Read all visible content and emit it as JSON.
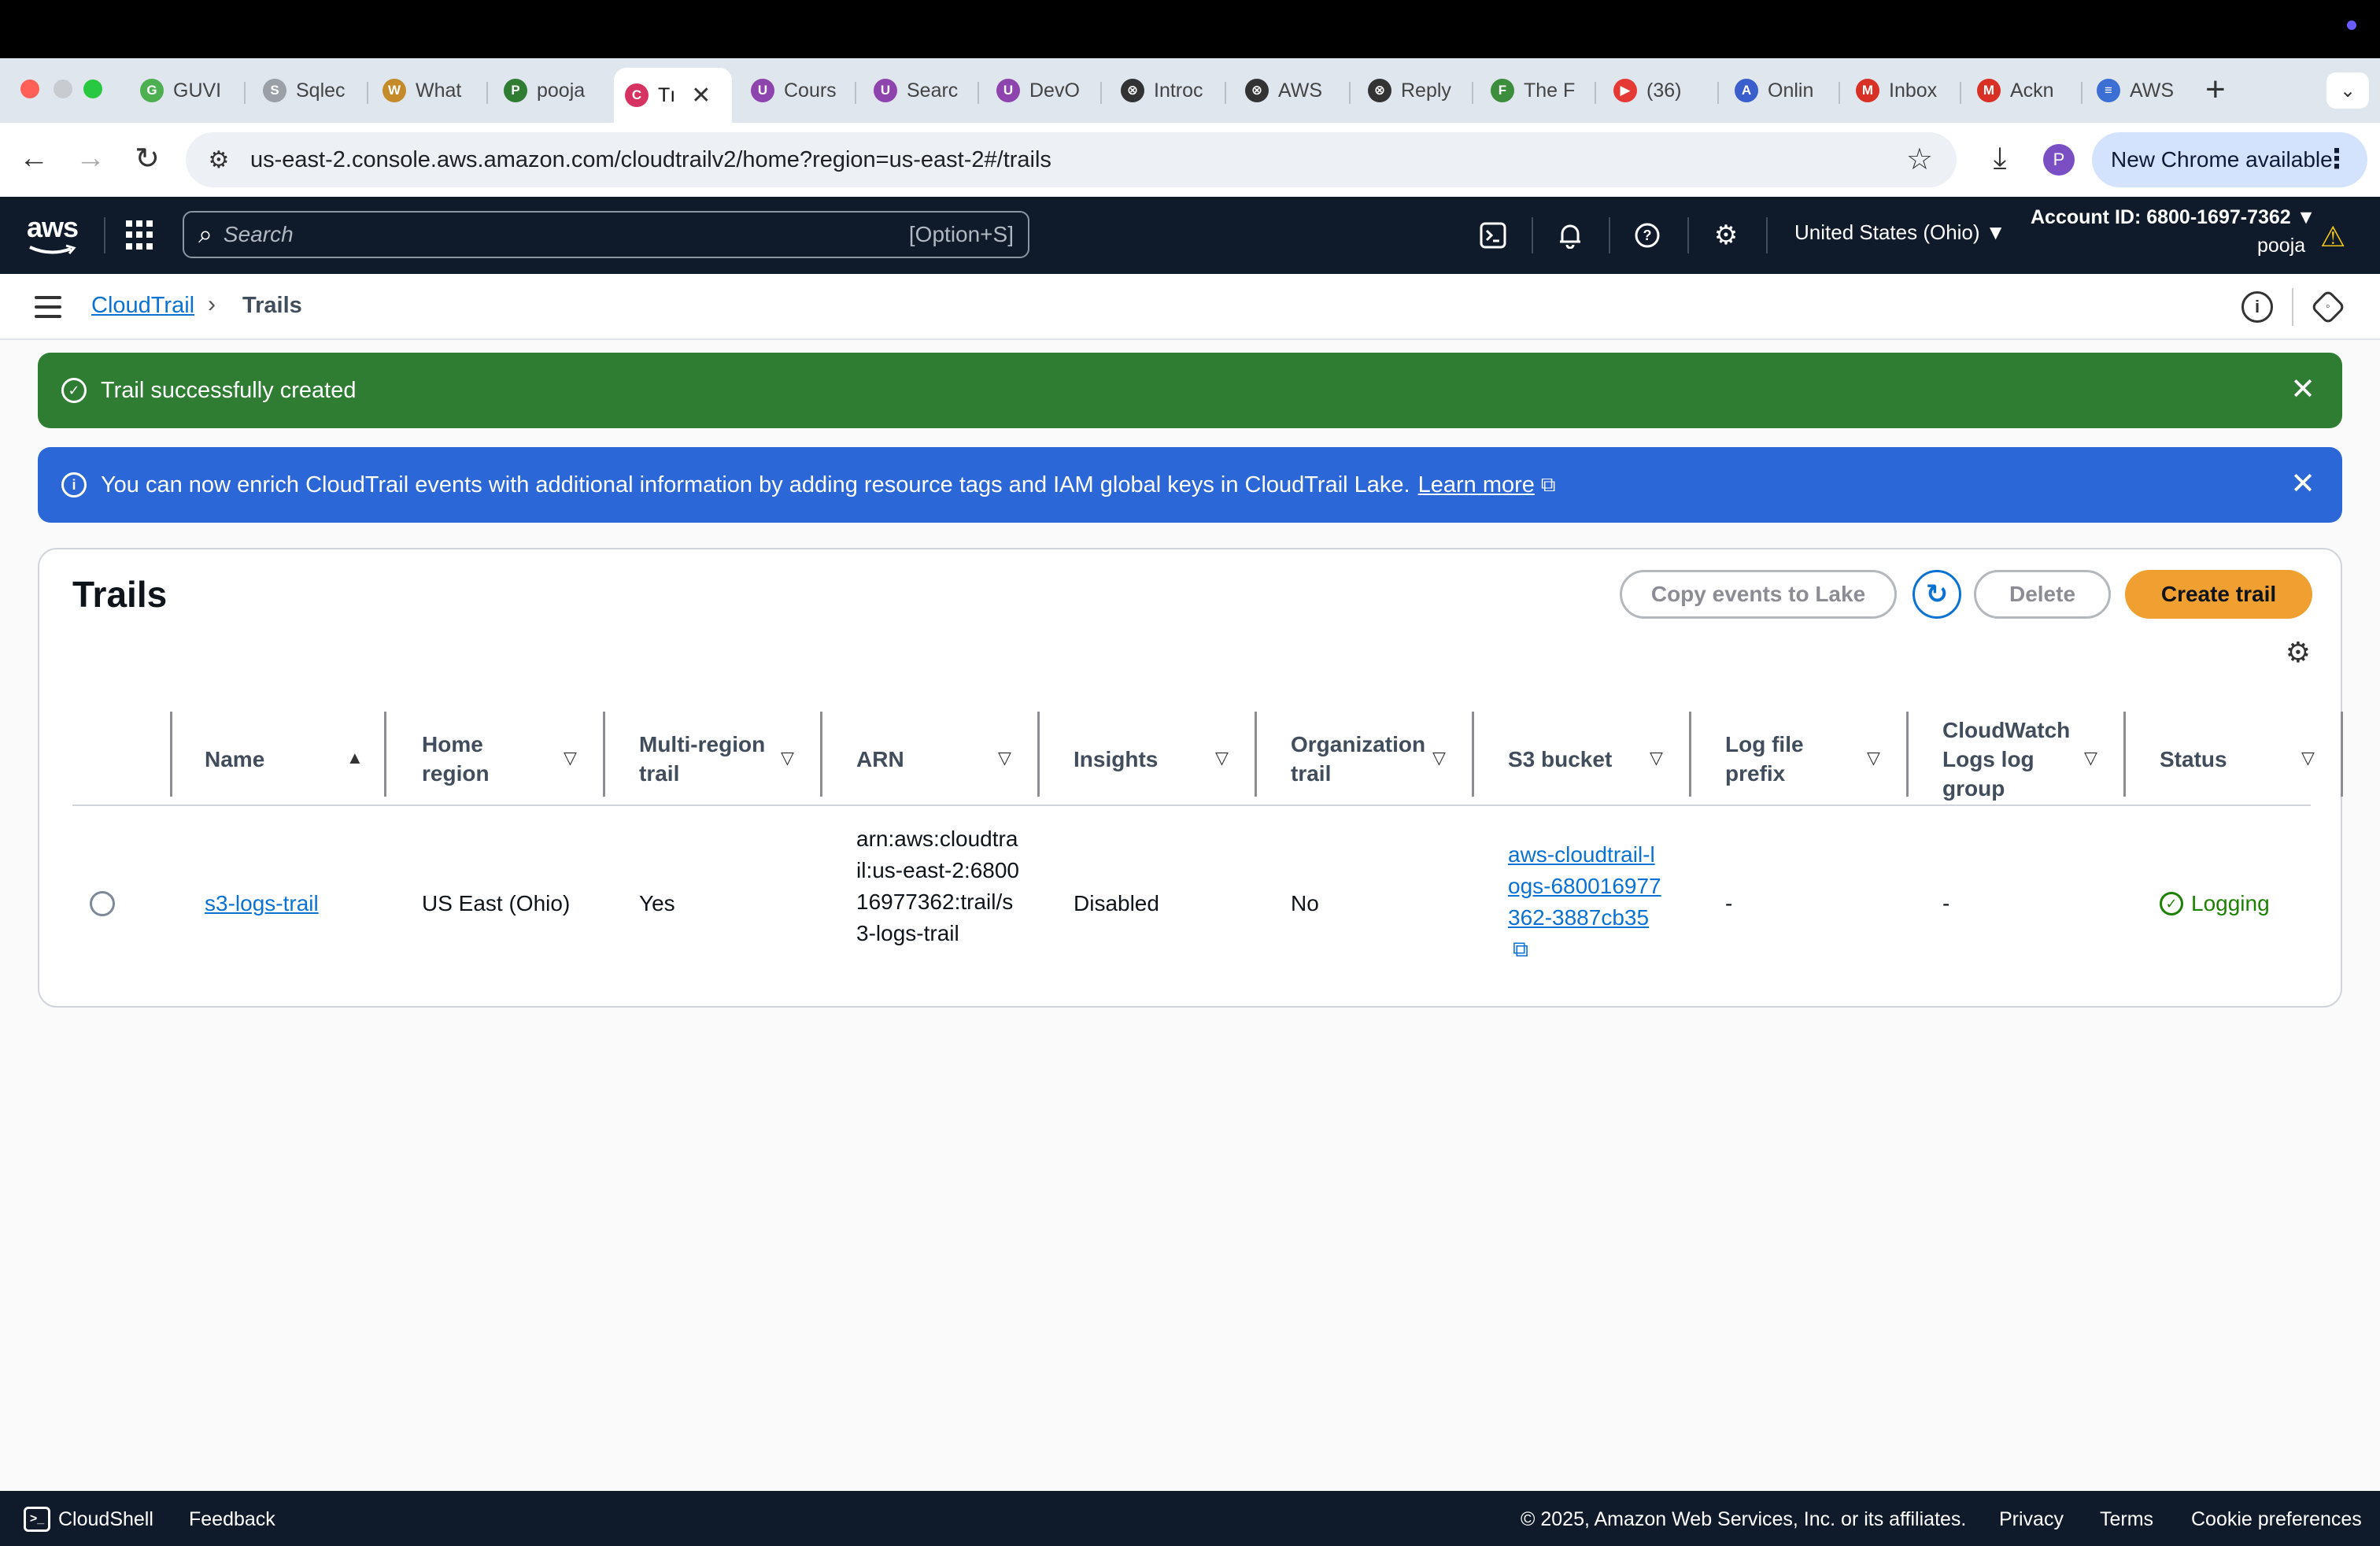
{
  "browser": {
    "tabs": [
      {
        "label": "GUVI",
        "fav_color": "#4caf50",
        "fav": "G"
      },
      {
        "label": "Sqlec",
        "fav_color": "#9aa0a6",
        "fav": "S"
      },
      {
        "label": "What",
        "fav_color": "#c58b2a",
        "fav": "W"
      },
      {
        "label": "pooja",
        "fav_color": "#2e7d32",
        "fav": "P"
      },
      {
        "label": "Tı",
        "fav_color": "#d63262",
        "fav": "C"
      },
      {
        "label": "Cours",
        "fav_color": "#8e44ad",
        "fav": "U"
      },
      {
        "label": "Searc",
        "fav_color": "#8e44ad",
        "fav": "U"
      },
      {
        "label": "DevO",
        "fav_color": "#8e44ad",
        "fav": "U"
      },
      {
        "label": "Introc",
        "fav_color": "#333333",
        "fav": "⊗"
      },
      {
        "label": "AWS",
        "fav_color": "#333333",
        "fav": "⊗"
      },
      {
        "label": "Reply",
        "fav_color": "#333333",
        "fav": "⊗"
      },
      {
        "label": "The F",
        "fav_color": "#3c8d3c",
        "fav": "F"
      },
      {
        "label": "(36) ",
        "fav_color": "#e53935",
        "fav": "▶"
      },
      {
        "label": "Onlin",
        "fav_color": "#3a5fcd",
        "fav": "A"
      },
      {
        "label": "Inbox",
        "fav_color": "#d93025",
        "fav": "M"
      },
      {
        "label": "Ackn",
        "fav_color": "#d93025",
        "fav": "M"
      },
      {
        "label": "AWS",
        "fav_color": "#3b6fd4",
        "fav": "≡"
      }
    ],
    "url": "us-east-2.console.aws.amazon.com/cloudtrailv2/home?region=us-east-2#/trails",
    "profile_initial": "P",
    "chrome_available": "New Chrome available"
  },
  "aws_header": {
    "logo": "aws",
    "search_placeholder": "Search",
    "search_shortcut": "[Option+S]",
    "region": "United States (Ohio) ▼",
    "account": "Account ID: 6800-1697-7362 ▼",
    "user": "pooja"
  },
  "breadcrumb": {
    "service": "CloudTrail",
    "current": "Trails"
  },
  "flash_success": {
    "text": "Trail successfully created"
  },
  "flash_info": {
    "text": "You can now enrich CloudTrail events with additional information by adding resource tags and IAM global keys in CloudTrail Lake.",
    "link": "Learn more"
  },
  "trails": {
    "title": "Trails",
    "buttons": {
      "copy": "Copy events to Lake",
      "delete": "Delete",
      "create": "Create trail"
    },
    "columns": {
      "name": "Name",
      "home_region": "Home region",
      "multi_region": "Multi-region trail",
      "arn": "ARN",
      "insights": "Insights",
      "organization": "Organization trail",
      "s3_bucket": "S3 bucket",
      "log_prefix": "Log file prefix",
      "cloudwatch": "CloudWatch Logs log group",
      "status": "Status"
    },
    "rows": [
      {
        "name": "s3-logs-trail",
        "home_region": "US East (Ohio)",
        "multi_region": "Yes",
        "arn": "arn:aws:cloudtrail:us-east-2:680016977362:trail/s3-logs-trail",
        "insights": "Disabled",
        "organization": "No",
        "s3_bucket": "aws-cloudtrail-logs-680016977362-3887cb35",
        "log_prefix": "-",
        "cloudwatch": "-",
        "status": "Logging"
      }
    ]
  },
  "footer": {
    "cloudshell": "CloudShell",
    "feedback": "Feedback",
    "copyright": "© 2025, Amazon Web Services, Inc. or its affiliates.",
    "privacy": "Privacy",
    "terms": "Terms",
    "cookies": "Cookie preferences"
  }
}
